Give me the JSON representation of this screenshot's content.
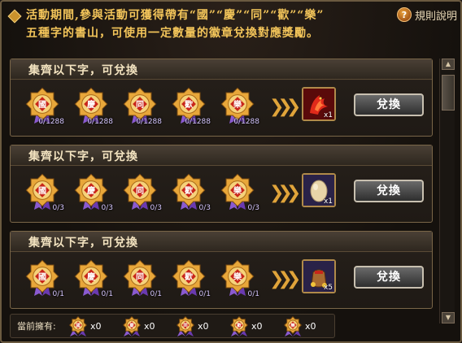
{
  "header": {
    "notice_line1": "活動期間,參與活動可獲得帶有“國”“慶”“同”“歡”“樂”",
    "notice_line2": "五種字的書山，可使用一定數量的徽章兌換對應獎勵。",
    "help_label": "規則說明",
    "help_icon": "?"
  },
  "panels": [
    {
      "title": "集齊以下字，可兌換",
      "badges": [
        {
          "char": "國",
          "count": "0/1288"
        },
        {
          "char": "慶",
          "count": "0/1288"
        },
        {
          "char": "同",
          "count": "0/1288"
        },
        {
          "char": "歡",
          "count": "0/1288"
        },
        {
          "char": "樂",
          "count": "0/1288"
        }
      ],
      "reward_icon": "red-phoenix-icon",
      "reward_qty": "x1",
      "button": "兌換"
    },
    {
      "title": "集齊以下字，可兌換",
      "badges": [
        {
          "char": "國",
          "count": "0/3"
        },
        {
          "char": "慶",
          "count": "0/3"
        },
        {
          "char": "同",
          "count": "0/3"
        },
        {
          "char": "歡",
          "count": "0/3"
        },
        {
          "char": "樂",
          "count": "0/3"
        }
      ],
      "reward_icon": "egg-icon",
      "reward_qty": "x1",
      "button": "兌換"
    },
    {
      "title": "集齊以下字，可兌換",
      "badges": [
        {
          "char": "國",
          "count": "0/1"
        },
        {
          "char": "慶",
          "count": "0/1"
        },
        {
          "char": "同",
          "count": "0/1"
        },
        {
          "char": "歡",
          "count": "0/1"
        },
        {
          "char": "樂",
          "count": "0/1"
        }
      ],
      "reward_icon": "treasure-bag-icon",
      "reward_qty": "x5",
      "button": "兌換"
    }
  ],
  "footer": {
    "label": "當前擁有:",
    "items": [
      {
        "char": "國",
        "qty": "x0"
      },
      {
        "char": "慶",
        "qty": "x0"
      },
      {
        "char": "同",
        "qty": "x0"
      },
      {
        "char": "歡",
        "qty": "x0"
      },
      {
        "char": "樂",
        "qty": "x0"
      }
    ]
  },
  "colors": {
    "notice_text": "#f3c55a",
    "badge_gold": "#e8a73a",
    "badge_red": "#c8261a",
    "ribbon_purple": "#8a5ad0"
  }
}
